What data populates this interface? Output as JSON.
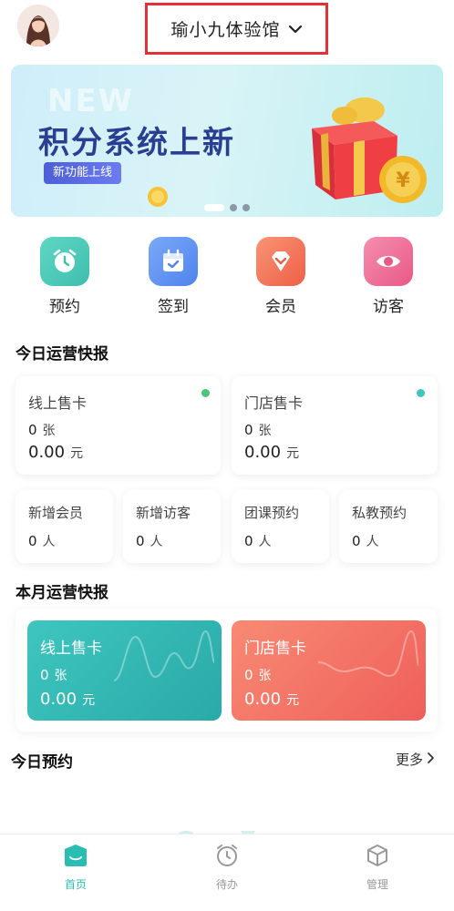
{
  "header": {
    "store_name": "瑜小九体验馆"
  },
  "banner": {
    "ghost_text": "NEW",
    "title": "积分系统上新",
    "tag": "新功能上线"
  },
  "quick_actions": [
    {
      "label": "预约",
      "icon": "alarm-clock-icon",
      "color": "#46c7b5"
    },
    {
      "label": "签到",
      "icon": "calendar-check-icon",
      "color": "#5b8ef2"
    },
    {
      "label": "会员",
      "icon": "diamond-icon",
      "color": "#f1745a"
    },
    {
      "label": "访客",
      "icon": "eye-icon",
      "color": "#ee6b8f"
    }
  ],
  "today": {
    "title": "今日运营快报",
    "online": {
      "title": "线上售卡",
      "count": "0",
      "count_unit": "张",
      "amount": "0.00",
      "amount_unit": "元",
      "dot_color": "#4cc47a"
    },
    "store": {
      "title": "门店售卡",
      "count": "0",
      "count_unit": "张",
      "amount": "0.00",
      "amount_unit": "元",
      "dot_color": "#3fc6c0"
    },
    "small": [
      {
        "title": "新增会员",
        "value": "0",
        "unit": "人"
      },
      {
        "title": "新增访客",
        "value": "0",
        "unit": "人"
      },
      {
        "title": "团课预约",
        "value": "0",
        "unit": "人"
      },
      {
        "title": "私教预约",
        "value": "0",
        "unit": "人"
      }
    ]
  },
  "month": {
    "title": "本月运营快报",
    "online": {
      "title": "线上售卡",
      "count": "0",
      "count_unit": "张",
      "amount": "0.00",
      "amount_unit": "元"
    },
    "store": {
      "title": "门店售卡",
      "count": "0",
      "count_unit": "张",
      "amount": "0.00",
      "amount_unit": "元"
    }
  },
  "appointments": {
    "title": "今日预约",
    "more": "更多"
  },
  "tabbar": {
    "items": [
      {
        "label": "首页",
        "active": true
      },
      {
        "label": "待办",
        "active": false
      },
      {
        "label": "管理",
        "active": false
      }
    ],
    "active_color": "#2bbdb3"
  }
}
